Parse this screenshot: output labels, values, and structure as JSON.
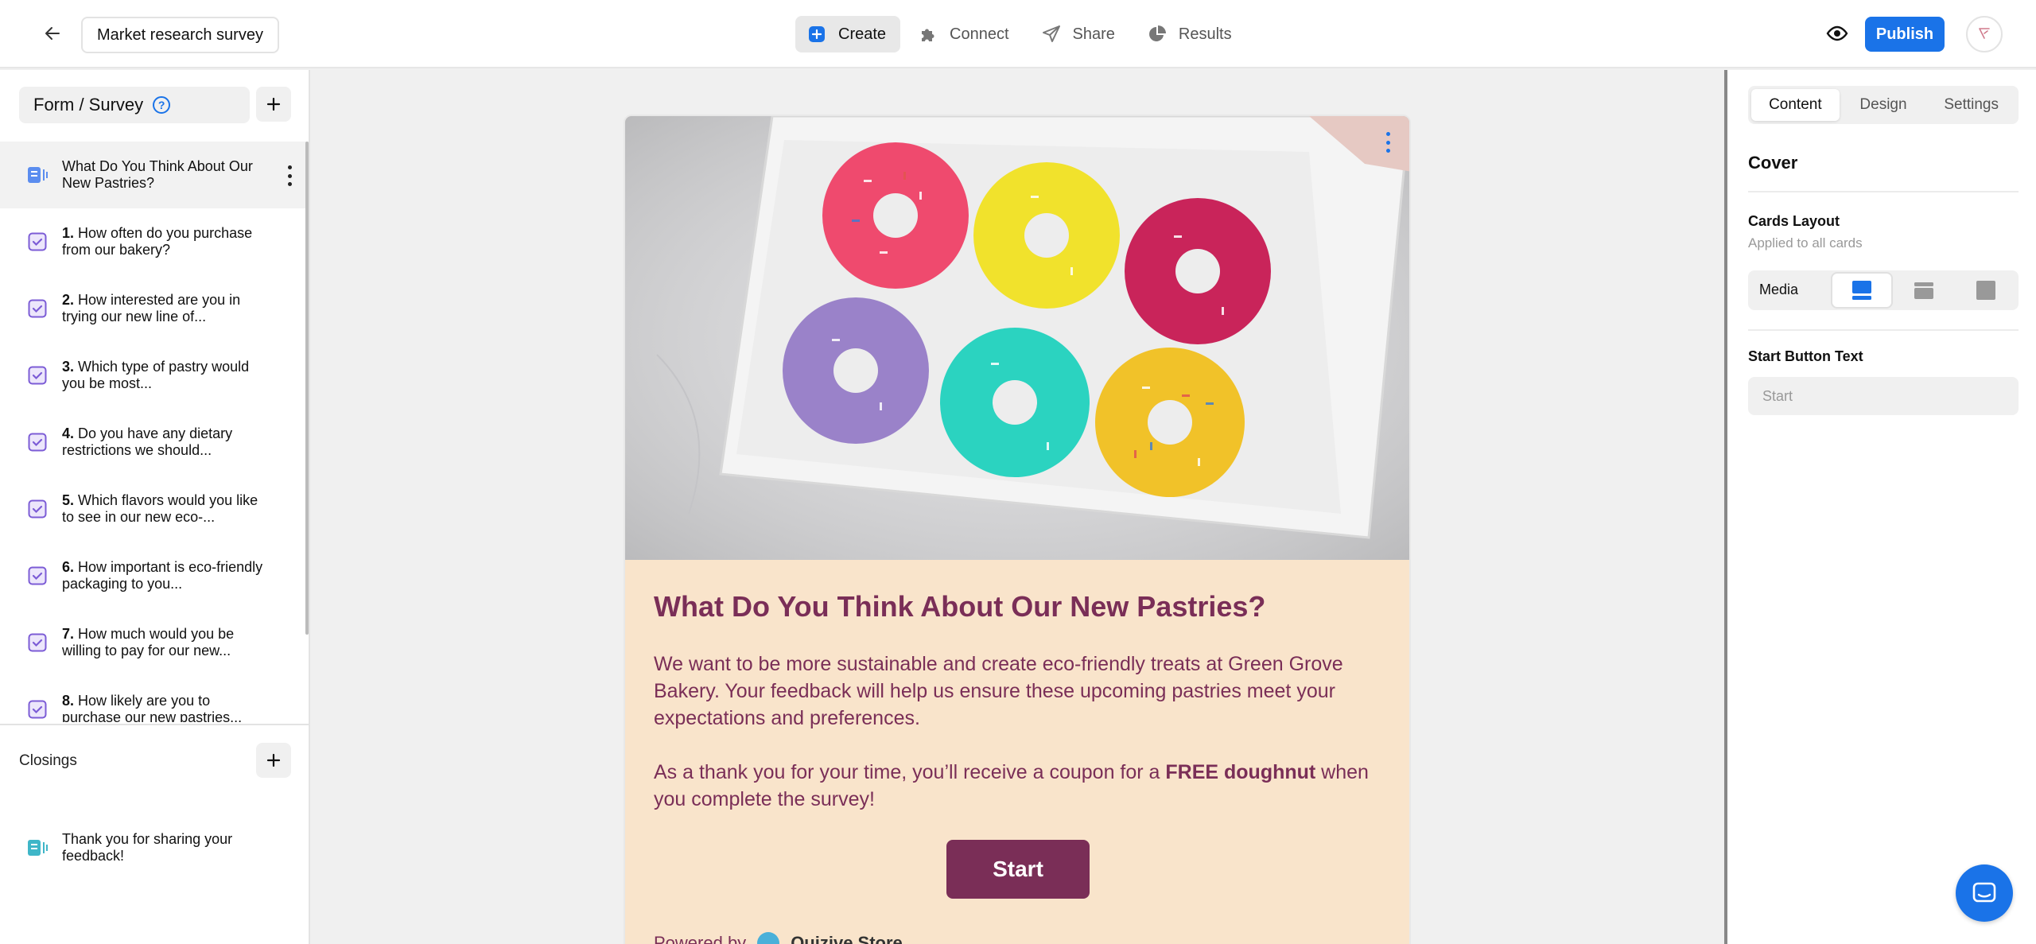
{
  "header": {
    "doc_title": "Market research survey",
    "nav": [
      {
        "label": "Create",
        "icon": "plus-square-icon"
      },
      {
        "label": "Connect",
        "icon": "puzzle-icon"
      },
      {
        "label": "Share",
        "icon": "paper-plane-icon"
      },
      {
        "label": "Results",
        "icon": "pie-chart-icon"
      }
    ],
    "publish_label": "Publish"
  },
  "sidebar": {
    "section_label": "Form / Survey",
    "cover_item": "What Do You Think About Our New Pastries?",
    "items": [
      {
        "num": "1.",
        "text": "How often do you purchase from our bakery?"
      },
      {
        "num": "2.",
        "text": "How interested are you in trying our new line of..."
      },
      {
        "num": "3.",
        "text": "Which type of pastry would you be most..."
      },
      {
        "num": "4.",
        "text": "Do you have any dietary restrictions we should..."
      },
      {
        "num": "5.",
        "text": "Which flavors would you like to see in our new eco-..."
      },
      {
        "num": "6.",
        "text": "How important is eco-friendly packaging to you..."
      },
      {
        "num": "7.",
        "text": "How much would you be willing to pay for our new..."
      },
      {
        "num": "8.",
        "text": "How likely are you to purchase our new pastries..."
      }
    ],
    "closings_label": "Closings",
    "closing_item": "Thank you for sharing your feedback!"
  },
  "card": {
    "title": "What Do You Think About Our New Pastries?",
    "body_1": "We want to be more sustainable and create eco-friendly treats at Green Grove Bakery. Your feedback will help us ensure these upcoming pastries meet your expectations and preferences.",
    "body_2_pre": "As a thank you for your time, you’ll receive a coupon for a ",
    "body_2_bold": "FREE doughnut",
    "body_2_post": " when you complete the survey!",
    "start_label": "Start",
    "powered_prefix": "Powered by",
    "powered_brand": "Quizive Store",
    "colors": {
      "accent": "#7a2e57",
      "background": "#f9e4cb"
    }
  },
  "right_panel": {
    "tabs": [
      "Content",
      "Design",
      "Settings"
    ],
    "section_title": "Cover",
    "cards_layout_label": "Cards Layout",
    "cards_layout_sub": "Applied to all cards",
    "media_label": "Media",
    "start_button_label": "Start Button Text",
    "start_button_placeholder": "Start"
  },
  "colors": {
    "primary": "#1a73e8",
    "checkbox": "#7c5cd6"
  }
}
